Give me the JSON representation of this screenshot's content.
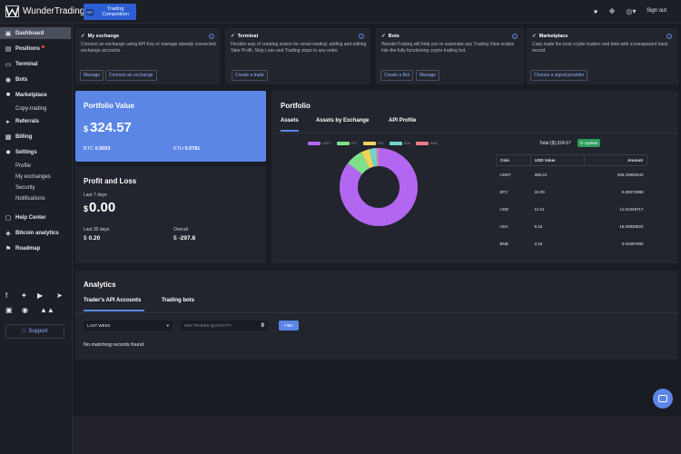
{
  "topbar": {
    "brand": "WunderTrading",
    "promo_badge": "WT",
    "promo_text": "Trading Competition",
    "signout": "Sign out",
    "icons": [
      "user-icon",
      "settings-icon",
      "globe-icon"
    ]
  },
  "sidebar": {
    "items": [
      {
        "label": "Dashboard",
        "icon": "dashboard-icon"
      },
      {
        "label": "Positions",
        "icon": "positions-icon"
      },
      {
        "label": "Terminal",
        "icon": "terminal-icon"
      },
      {
        "label": "Bots",
        "icon": "bot-icon"
      },
      {
        "label": "Marketplace",
        "icon": "marketplace-icon"
      },
      {
        "label": "Copy-trading"
      },
      {
        "label": "Referrals",
        "icon": "megaphone-icon"
      },
      {
        "label": "Billing",
        "icon": "billing-icon"
      },
      {
        "label": "Settings",
        "icon": "gear-icon"
      },
      {
        "label": "Profile"
      },
      {
        "label": "My exchanges"
      },
      {
        "label": "Security"
      },
      {
        "label": "Notifications"
      },
      {
        "label": "Help Center",
        "icon": "help-icon"
      },
      {
        "label": "Bitcoin analytics",
        "icon": "bitcoin-icon"
      },
      {
        "label": "Roadmap",
        "icon": "roadmap-icon"
      }
    ],
    "support": "Support"
  },
  "cards": [
    {
      "title": "My exchange",
      "desc": "Connect an exchange using API Key or manage already connected exchange accounts.",
      "buttons": [
        "Manage",
        "Connect an exchange"
      ]
    },
    {
      "title": "Terminal",
      "desc": "Flexible way of creating orders for smart trading: adding and editing Take Profit, Stop Loss and Trading stops to any order.",
      "buttons": [
        "Create a trade"
      ]
    },
    {
      "title": "Bots",
      "desc": "WunderTrading will help you to automate any Trading View scripts into the fully functioning crypto trading bot.",
      "buttons": [
        "Create a Bot",
        "Manage"
      ]
    },
    {
      "title": "Marketplace",
      "desc": "Copy trade the best crypto traders and bots with a transparent track record.",
      "buttons": [
        "Choose a signal provider"
      ]
    }
  ],
  "portfolio_value": {
    "title": "Portfolio Value",
    "currency": "$",
    "value": "324.57",
    "btc_label": "BTC",
    "btc_value": "0.0053",
    "eth_label": "ETH",
    "eth_value": "0.0781"
  },
  "profit_loss": {
    "title": "Profit and Loss",
    "last7_label": "Last 7 days",
    "currency": "$",
    "last7_value": "0.00",
    "last30_label": "Last 30 days",
    "last30_value": "0.20",
    "overall_label": "Overall",
    "overall_value": "-297.8"
  },
  "portfolio": {
    "title": "Portfolio",
    "tabs": [
      "Assets",
      "Assets by Exchange",
      "API Profile"
    ],
    "total": "Total ($):324.57",
    "update": "Update",
    "legend": [
      {
        "name": "USDT",
        "color": "#b366f2"
      },
      {
        "name": "BTC",
        "color": "#7fe08a"
      },
      {
        "name": "USD",
        "color": "#f0d35a"
      },
      {
        "name": "ADA",
        "color": "#6fd3d0"
      },
      {
        "name": "BNB",
        "color": "#f07a8a"
      }
    ],
    "table_headers": [
      "Coin",
      "USD Value",
      "Amount"
    ],
    "rows": [
      {
        "coin": "USDT",
        "usd": "265.24",
        "amount": "265.23903443"
      },
      {
        "coin": "BTC",
        "usd": "22.09",
        "amount": "0.00072988"
      },
      {
        "coin": "USD",
        "usd": "11.01",
        "amount": "11.01349717"
      },
      {
        "coin": "ADA",
        "usd": "9.16",
        "amount": "16.00830822"
      },
      {
        "coin": "BNB",
        "usd": "3.15",
        "amount": "0.01097590"
      }
    ]
  },
  "chart_data": {
    "type": "pie",
    "categories": [
      "USDT",
      "BTC",
      "USD",
      "ADA",
      "BNB"
    ],
    "values": [
      265.24,
      22.09,
      11.01,
      9.16,
      3.15
    ],
    "colors": [
      "#b366f2",
      "#7fe08a",
      "#f0d35a",
      "#6fd3d0",
      "#f07a8a"
    ],
    "legend_position": "top"
  },
  "analytics": {
    "title": "Analytics",
    "tabs": [
      "Trader's API Accounts",
      "Trading bots"
    ],
    "period": "LAST WEEK",
    "qty_label": "MIN TRADES QUANTITY",
    "qty_value": "0",
    "filter": "Filter",
    "empty": "No matching records found."
  }
}
